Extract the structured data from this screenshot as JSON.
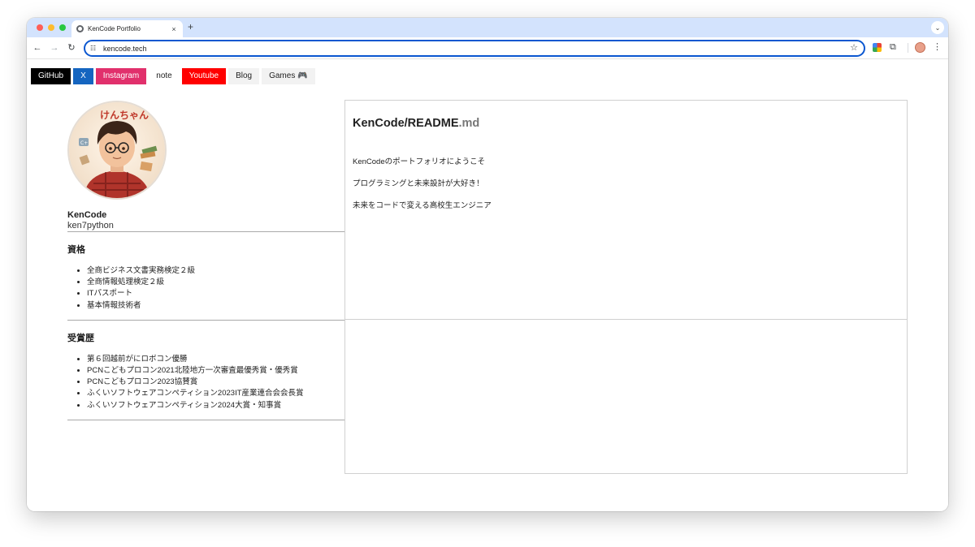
{
  "browser": {
    "tab_title": "KenCode Portfolio",
    "tab_close": "×",
    "new_tab": "+",
    "tab_search": "⌄",
    "url": "kencode.tech",
    "icons": [
      "back-icon",
      "forward-icon",
      "reload-icon",
      "site-info-icon",
      "bookmark-star-icon",
      "extensions-icon",
      "profile-avatar-icon",
      "menu-icon"
    ]
  },
  "nav": {
    "links": [
      {
        "label": "GitHub",
        "bg": "#000000",
        "color": "#ffffff"
      },
      {
        "label": "X",
        "bg": "#1565c0",
        "color": "#ffffff"
      },
      {
        "label": "Instagram",
        "bg": "#e1306c",
        "color": "#ffffff"
      },
      {
        "label": "note",
        "bg": "#ffffff",
        "color": "#1f1f1f"
      },
      {
        "label": "Youtube",
        "bg": "#ff0000",
        "color": "#ffffff"
      },
      {
        "label": "Blog",
        "bg": "#f2f2f2",
        "color": "#1f1f1f"
      },
      {
        "label": "Games 🎮",
        "bg": "#f2f2f2",
        "color": "#1f1f1f"
      }
    ]
  },
  "profile": {
    "name": "KenCode",
    "handle": "ken7python",
    "avatar_text": "けんちゃん"
  },
  "qualifications": {
    "heading": "資格",
    "items": [
      "全商ビジネス文書実務検定２級",
      "全商情報処理検定２級",
      "ITパスポート",
      "基本情報技術者"
    ]
  },
  "awards": {
    "heading": "受賞歴",
    "items": [
      "第６回越前がにロボコン優勝",
      "PCNこどもプロコン2021北陸地方一次審査最優秀賞・優秀賞",
      "PCNこどもプロコン2023協賛賞",
      "ふくいソフトウェアコンペティション2023IT産業連合会会長賞",
      "ふくいソフトウェアコンペティション2024大賞・知事賞"
    ]
  },
  "readme": {
    "title": "KenCode/README",
    "ext": ".md",
    "lines": [
      "KenCodeのポートフォリオにようこそ",
      "プログラミングと未来設計が大好き！",
      "未来をコードで変える高校生エンジニア"
    ]
  }
}
